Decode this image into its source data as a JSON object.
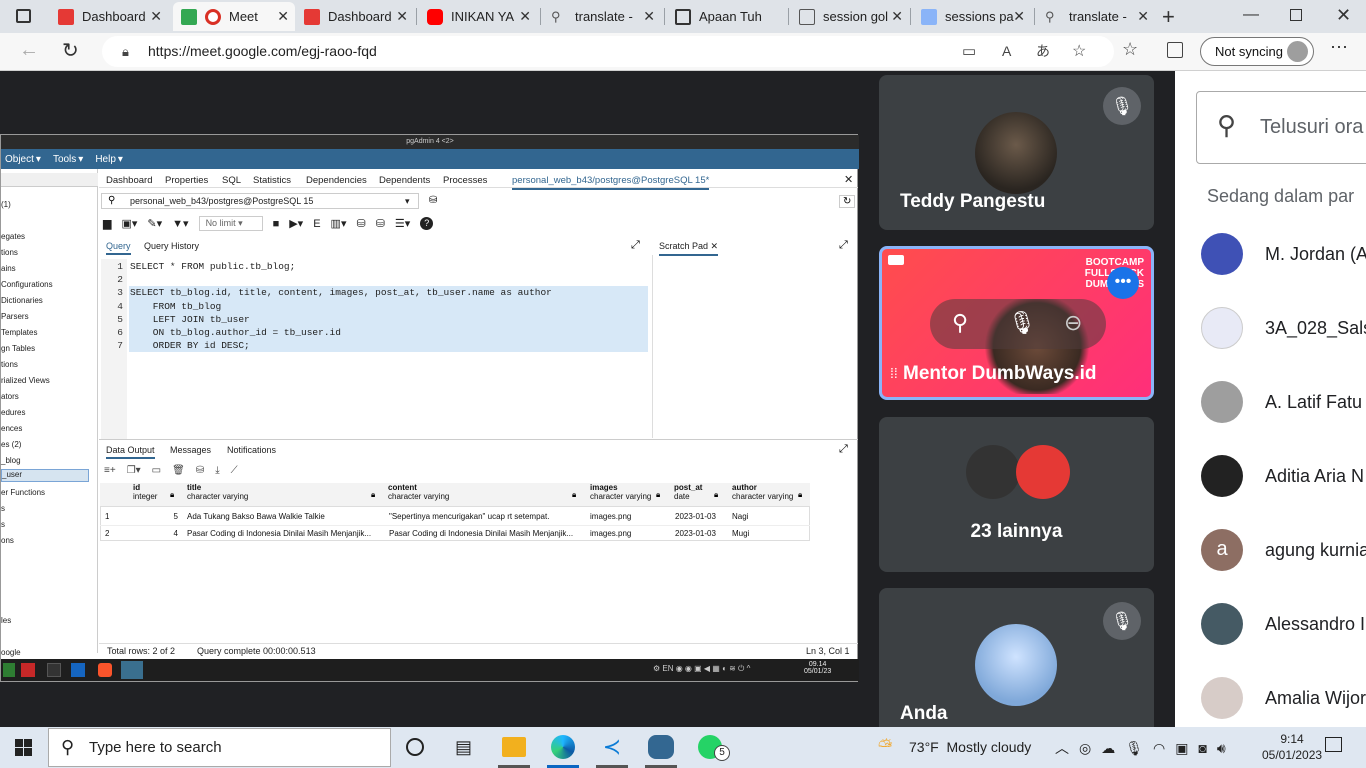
{
  "browser": {
    "tabs": [
      {
        "label": "Dashboard"
      },
      {
        "label": "Meet"
      },
      {
        "label": "Dashboard"
      },
      {
        "label": "INIKAN YA"
      },
      {
        "label": "translate -"
      },
      {
        "label": "Apaan Tuh"
      },
      {
        "label": "session gol"
      },
      {
        "label": "sessions pa"
      },
      {
        "label": "translate -"
      }
    ],
    "url": "https://meet.google.com/egj-raoo-fqd",
    "sync_label": "Not syncing"
  },
  "pgadmin": {
    "title": "pgAdmin 4 <2>",
    "menu": [
      "Object",
      "Tools",
      "Help"
    ],
    "tabs": [
      "Dashboard",
      "Properties",
      "SQL",
      "Statistics",
      "Dependencies",
      "Dependents",
      "Processes",
      "personal_web_b43/postgres@PostgreSQL 15*"
    ],
    "connection": "personal_web_b43/postgres@PostgreSQL 15",
    "limit": "No limit",
    "editor_tabs": [
      "Query",
      "Query History"
    ],
    "scratch": "Scratch Pad",
    "sidebar": [
      "(1)",
      "egates",
      "tions",
      "ains",
      "Configurations",
      "Dictionaries",
      "Parsers",
      "Templates",
      "gn Tables",
      "tions",
      "rialized Views",
      "ators",
      "edures",
      "ences",
      "es (2)",
      "_blog",
      "_user",
      "er Functions",
      "s",
      "s",
      "ons",
      "les",
      "oogle"
    ],
    "code_lines": [
      {
        "n": "1",
        "text": "SELECT * FROM public.tb_blog;"
      },
      {
        "n": "2",
        "text": ""
      },
      {
        "n": "3",
        "text": "SELECT tb_blog.id, title, content, images, post_at, tb_user.name as author"
      },
      {
        "n": "4",
        "text": "    FROM tb_blog"
      },
      {
        "n": "5",
        "text": "    LEFT JOIN tb_user"
      },
      {
        "n": "6",
        "text": "    ON tb_blog.author_id = tb_user.id"
      },
      {
        "n": "7",
        "text": "    ORDER BY id DESC;"
      }
    ],
    "result_tabs": [
      "Data Output",
      "Messages",
      "Notifications"
    ],
    "columns": [
      {
        "name": "id",
        "type": "integer"
      },
      {
        "name": "title",
        "type": "character varying"
      },
      {
        "name": "content",
        "type": "character varying"
      },
      {
        "name": "images",
        "type": "character varying"
      },
      {
        "name": "post_at",
        "type": "date"
      },
      {
        "name": "author",
        "type": "character varying"
      }
    ],
    "rows": [
      {
        "n": "1",
        "id": "5",
        "title": "Ada Tukang Bakso Bawa Walkie Talkie",
        "content": "\"Sepertinya mencurigakan\" ucap rt setempat.",
        "images": "images.png",
        "post_at": "2023-01-03",
        "author": "Nagi"
      },
      {
        "n": "2",
        "id": "4",
        "title": "Pasar Coding di Indonesia Dinilai Masih Menjanjik...",
        "content": "Pasar Coding di Indonesia Dinilai Masih Menjanjik...",
        "images": "images.png",
        "post_at": "2023-01-03",
        "author": "Mugi"
      }
    ],
    "status_rows": "Total rows: 2 of 2",
    "status_query": "Query complete 00:00:00.513",
    "status_pos": "Ln 3, Col 1",
    "inner_time": "09.14",
    "inner_date": "05/01/23"
  },
  "meet": {
    "tiles": [
      {
        "name": "Teddy Pangestu"
      },
      {
        "name": "Mentor DumbWays.id",
        "banner": "BOOTCAMP FULLSTACK DUMBWAYS"
      },
      {
        "name": "23 lainnya"
      },
      {
        "name": "Anda"
      }
    ]
  },
  "people": {
    "search_placeholder": "Telusuri ora",
    "section": "Sedang dalam par",
    "list": [
      "M. Jordan (A",
      "3A_028_Sals",
      "A. Latif Fatu",
      "Aditia Aria N",
      "agung kurnia",
      "Alessandro I",
      "Amalia Wijor"
    ],
    "initial": "a"
  },
  "taskbar": {
    "search": "Type here to search",
    "weather": "73°F  Mostly cloudy",
    "time": "9:14",
    "date": "05/01/2023",
    "badge": "5"
  }
}
